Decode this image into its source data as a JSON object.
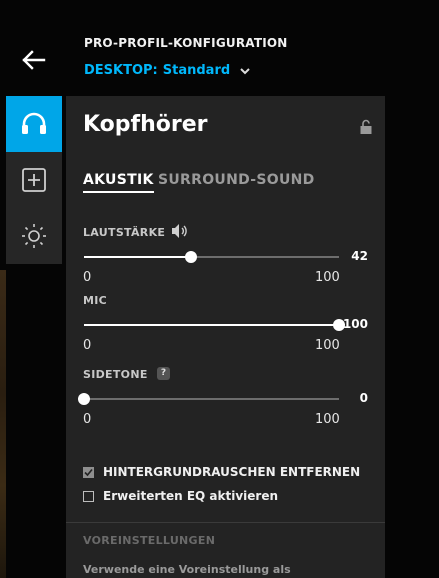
{
  "header": {
    "title": "PRO-PROFIL-KONFIGURATION",
    "profile_prefix": "DESKTOP:",
    "profile_name": "Standard"
  },
  "sidebar": {
    "items": [
      {
        "name": "headphones-icon",
        "active": true
      },
      {
        "name": "add-icon",
        "active": false
      },
      {
        "name": "lighting-icon",
        "active": false
      }
    ]
  },
  "panel": {
    "title": "Kopfhörer",
    "tabs": [
      {
        "label": "AKUSTIK",
        "active": true
      },
      {
        "label": "SURROUND-SOUND",
        "active": false
      }
    ],
    "sliders": {
      "volume": {
        "label": "LAUTSTÄRKE",
        "value": "42",
        "min": "0",
        "max": "100"
      },
      "mic": {
        "label": "MIC",
        "value": "100",
        "min": "0",
        "max": "100"
      },
      "sidetone": {
        "label": "SIDETONE",
        "value": "0",
        "min": "0",
        "max": "100",
        "help": "?"
      }
    },
    "checkboxes": [
      {
        "label": "HINTERGRUNDRAUSCHEN ENTFERNEN",
        "checked": true
      },
      {
        "label": "Erweiterten EQ aktivieren",
        "checked": false
      }
    ],
    "presets": {
      "title": "VOREINSTELLUNGEN",
      "description": "Verwende eine Voreinstellung als"
    }
  },
  "colors": {
    "accent": "#00a6e8",
    "profile_text": "#00b8fc",
    "panel_bg": "#232323",
    "sidebar_bg": "#262626"
  }
}
